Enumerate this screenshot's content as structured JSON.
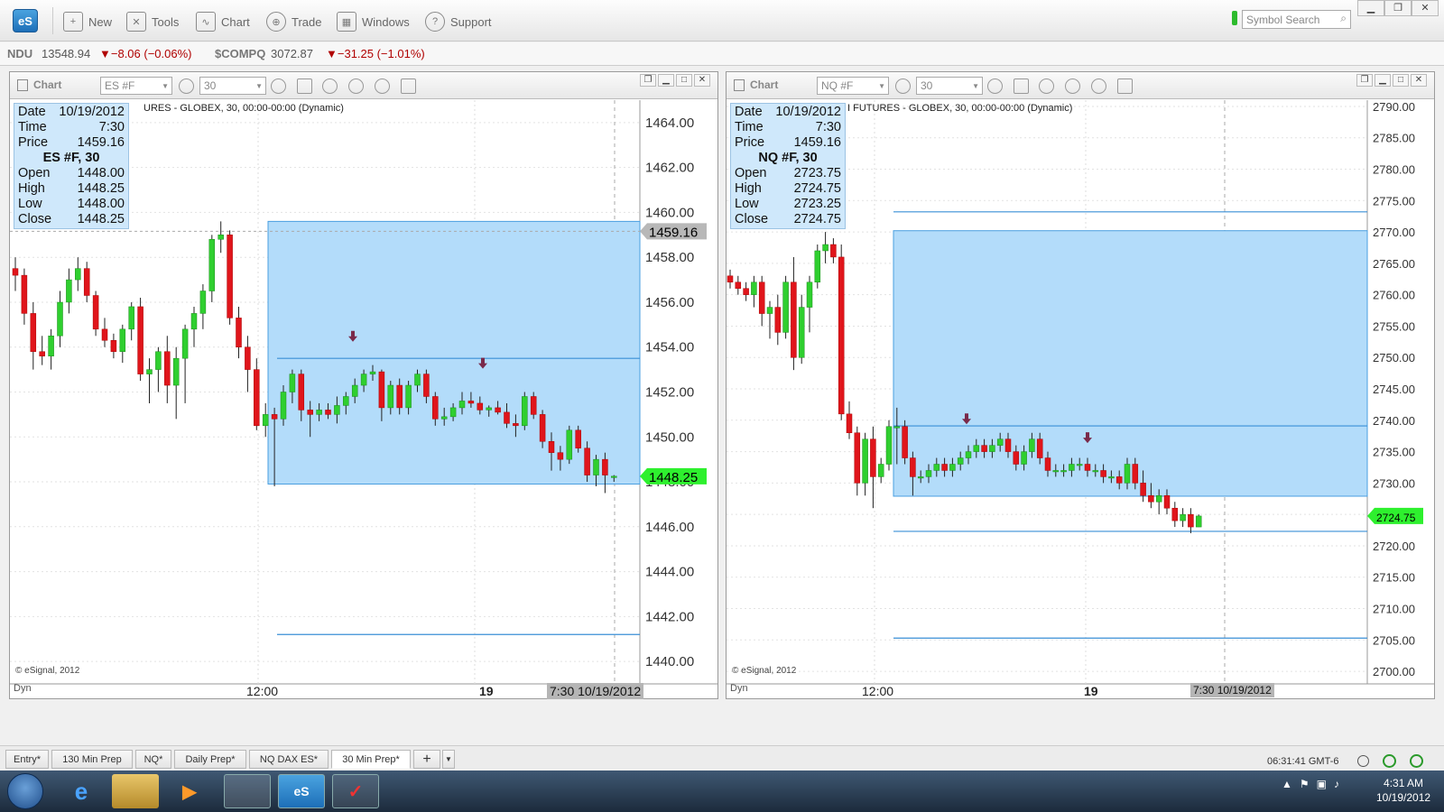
{
  "app": {
    "logo": "eS"
  },
  "toolbar": {
    "new": "New",
    "tools": "Tools",
    "chart": "Chart",
    "trade": "Trade",
    "windows": "Windows",
    "support": "Support",
    "symbol_search_placeholder": "Symbol Search"
  },
  "ticker": {
    "ndu_sym": "NDU",
    "ndu_val": "13548.94",
    "ndu_chg": "▼−8.06 (−0.06%)",
    "comp_sym": "$COMPQ",
    "comp_val": "3072.87",
    "comp_chg": "▼−31.25 (−1.01%)"
  },
  "panels": [
    {
      "title": "Chart",
      "symbol": "ES #F",
      "interval": "30",
      "description": "URES - GLOBEX, 30, 00:00-00:00 (Dynamic)",
      "info": {
        "date_label": "Date",
        "date": "10/19/2012",
        "time_label": "Time",
        "time": "7:30",
        "price_label": "Price",
        "price": "1459.16",
        "title": "ES #F, 30",
        "open_label": "Open",
        "open": "1448.00",
        "high_label": "High",
        "high": "1448.25",
        "low_label": "Low",
        "low": "1448.00",
        "close_label": "Close",
        "close": "1448.25"
      },
      "copyright": "© eSignal, 2012",
      "xlabel_1": "12:00",
      "xlabel_2": "19",
      "xcursor": "7:30 10/19/2012",
      "dyn": "Dyn",
      "cursor_price": "1459.16",
      "last_price": "1448.25"
    },
    {
      "title": "Chart",
      "symbol": "NQ #F",
      "interval": "30",
      "description": "I FUTURES - GLOBEX, 30, 00:00-00:00 (Dynamic)",
      "info": {
        "date_label": "Date",
        "date": "10/19/2012",
        "time_label": "Time",
        "time": "7:30",
        "price_label": "Price",
        "price": "1459.16",
        "title": "NQ #F, 30",
        "open_label": "Open",
        "open": "2723.75",
        "high_label": "High",
        "high": "2724.75",
        "low_label": "Low",
        "low": "2723.25",
        "close_label": "Close",
        "close": "2724.75"
      },
      "copyright": "© eSignal, 2012",
      "xlabel_1": "12:00",
      "xlabel_2": "19",
      "xcursor": "7:30 10/19/2012",
      "dyn": "Dyn",
      "last_price": "2724.75"
    }
  ],
  "chart_data": [
    {
      "type": "candlestick",
      "title": "ES #F, 30",
      "ylim": [
        1439,
        1465
      ],
      "yticks": [
        1440,
        1442,
        1444,
        1446,
        1448,
        1450,
        1452,
        1454,
        1456,
        1458,
        1460,
        1462,
        1464
      ],
      "ytick_labels": [
        "1440.00",
        "1442.00",
        "1444.00",
        "1446.00",
        "1448.00",
        "1450.00",
        "1452.00",
        "1454.00",
        "1456.00",
        "1458.00",
        "1460.00",
        "1462.00",
        "1464.00"
      ],
      "xticks": [
        "12:00",
        "19"
      ],
      "candles": [
        [
          1457.5,
          1458.0,
          1456.5,
          1457.2
        ],
        [
          1457.2,
          1457.5,
          1455.0,
          1455.5
        ],
        [
          1455.5,
          1456.0,
          1453.0,
          1453.8
        ],
        [
          1453.8,
          1454.5,
          1453.2,
          1453.6
        ],
        [
          1453.6,
          1454.8,
          1453.0,
          1454.5
        ],
        [
          1454.5,
          1456.5,
          1454.0,
          1456.0
        ],
        [
          1456.0,
          1457.5,
          1455.5,
          1457.0
        ],
        [
          1457.0,
          1458.0,
          1456.5,
          1457.5
        ],
        [
          1457.5,
          1457.8,
          1456.0,
          1456.3
        ],
        [
          1456.3,
          1456.5,
          1454.5,
          1454.8
        ],
        [
          1454.8,
          1455.3,
          1454.0,
          1454.3
        ],
        [
          1454.3,
          1454.6,
          1453.5,
          1453.8
        ],
        [
          1453.8,
          1455.0,
          1453.3,
          1454.8
        ],
        [
          1454.8,
          1456.0,
          1454.3,
          1455.8
        ],
        [
          1455.8,
          1456.2,
          1452.5,
          1452.8
        ],
        [
          1452.8,
          1453.5,
          1451.5,
          1453.0
        ],
        [
          1453.0,
          1454.0,
          1452.0,
          1453.8
        ],
        [
          1453.8,
          1454.5,
          1451.5,
          1452.3
        ],
        [
          1452.3,
          1454.0,
          1450.8,
          1453.5
        ],
        [
          1453.5,
          1455.0,
          1451.5,
          1454.8
        ],
        [
          1454.8,
          1455.8,
          1454.0,
          1455.5
        ],
        [
          1455.5,
          1456.8,
          1454.8,
          1456.5
        ],
        [
          1456.5,
          1459.0,
          1456.0,
          1458.8
        ],
        [
          1458.8,
          1459.6,
          1458.2,
          1459.0
        ],
        [
          1459.0,
          1459.2,
          1455.0,
          1455.3
        ],
        [
          1455.3,
          1455.8,
          1453.5,
          1454.0
        ],
        [
          1454.0,
          1454.5,
          1452.0,
          1453.0
        ],
        [
          1453.0,
          1453.5,
          1450.3,
          1450.5
        ],
        [
          1450.5,
          1451.5,
          1450.0,
          1451.0
        ],
        [
          1451.0,
          1451.3,
          1447.8,
          1450.8
        ],
        [
          1450.8,
          1452.3,
          1450.5,
          1452.0
        ],
        [
          1452.0,
          1453.0,
          1451.5,
          1452.8
        ],
        [
          1452.8,
          1453.0,
          1450.7,
          1451.2
        ],
        [
          1451.2,
          1451.6,
          1450.0,
          1451.0
        ],
        [
          1451.0,
          1451.5,
          1450.7,
          1451.2
        ],
        [
          1451.2,
          1451.5,
          1450.8,
          1451.0
        ],
        [
          1451.0,
          1451.8,
          1450.6,
          1451.4
        ],
        [
          1451.4,
          1452.0,
          1451.0,
          1451.8
        ],
        [
          1451.8,
          1452.6,
          1451.5,
          1452.3
        ],
        [
          1452.3,
          1453.0,
          1452.0,
          1452.8
        ],
        [
          1452.8,
          1453.2,
          1452.5,
          1452.9
        ],
        [
          1452.9,
          1453.0,
          1450.7,
          1451.3
        ],
        [
          1451.3,
          1452.5,
          1451.0,
          1452.3
        ],
        [
          1452.3,
          1452.6,
          1451.0,
          1451.3
        ],
        [
          1451.3,
          1452.5,
          1451.0,
          1452.3
        ],
        [
          1452.3,
          1453.0,
          1452.0,
          1452.8
        ],
        [
          1452.8,
          1453.0,
          1451.5,
          1451.8
        ],
        [
          1451.8,
          1452.0,
          1450.5,
          1450.8
        ],
        [
          1450.8,
          1451.3,
          1450.5,
          1450.9
        ],
        [
          1450.9,
          1451.5,
          1450.7,
          1451.3
        ],
        [
          1451.3,
          1452.0,
          1451.0,
          1451.6
        ],
        [
          1451.6,
          1452.0,
          1451.3,
          1451.5
        ],
        [
          1451.5,
          1451.8,
          1451.0,
          1451.2
        ],
        [
          1451.2,
          1451.4,
          1450.9,
          1451.3
        ],
        [
          1451.3,
          1451.6,
          1451.0,
          1451.1
        ],
        [
          1451.1,
          1451.5,
          1450.4,
          1450.6
        ],
        [
          1450.6,
          1451.0,
          1450.0,
          1450.5
        ],
        [
          1450.5,
          1452.0,
          1450.3,
          1451.8
        ],
        [
          1451.8,
          1452.0,
          1450.8,
          1451.0
        ],
        [
          1451.0,
          1451.2,
          1449.5,
          1449.8
        ],
        [
          1449.8,
          1450.2,
          1448.5,
          1449.3
        ],
        [
          1449.3,
          1449.6,
          1448.5,
          1449.0
        ],
        [
          1449.0,
          1450.5,
          1448.8,
          1450.3
        ],
        [
          1450.3,
          1450.5,
          1449.3,
          1449.5
        ],
        [
          1449.5,
          1449.8,
          1448.0,
          1448.3
        ],
        [
          1448.3,
          1449.2,
          1447.8,
          1449.0
        ],
        [
          1449.0,
          1449.3,
          1447.5,
          1448.3
        ],
        [
          1448.25,
          1448.3,
          1448.0,
          1448.25
        ]
      ],
      "shaded_zone": [
        1447.9,
        1459.6
      ],
      "hlines": [
        1453.5,
        1441.2
      ],
      "markers": [
        1454.0,
        1452.8
      ]
    },
    {
      "type": "candlestick",
      "title": "NQ #F, 30",
      "ylim": [
        2698,
        2791
      ],
      "yticks": [
        2700,
        2705,
        2710,
        2715,
        2720,
        2725,
        2730,
        2735,
        2740,
        2745,
        2750,
        2755,
        2760,
        2765,
        2770,
        2775,
        2780,
        2785,
        2790
      ],
      "ytick_labels": [
        "2700.00",
        "2705.00",
        "2710.00",
        "2715.00",
        "2720.00",
        "2725.00",
        "2730.00",
        "2735.00",
        "2740.00",
        "2745.00",
        "2750.00",
        "2755.00",
        "2760.00",
        "2765.00",
        "2770.00",
        "2775.00",
        "2780.00",
        "2785.00",
        "2790.00"
      ],
      "xticks": [
        "12:00",
        "19"
      ],
      "candles": [
        [
          2763,
          2764,
          2761,
          2762
        ],
        [
          2762,
          2763,
          2760,
          2761
        ],
        [
          2761,
          2762,
          2759,
          2760
        ],
        [
          2760,
          2763,
          2758,
          2762
        ],
        [
          2762,
          2763,
          2755,
          2757
        ],
        [
          2757,
          2759,
          2753,
          2758
        ],
        [
          2758,
          2760,
          2752,
          2754
        ],
        [
          2754,
          2763,
          2753,
          2762
        ],
        [
          2762,
          2766,
          2748,
          2750
        ],
        [
          2750,
          2760,
          2749,
          2758
        ],
        [
          2758,
          2763,
          2754,
          2762
        ],
        [
          2762,
          2768,
          2761,
          2767
        ],
        [
          2767,
          2770,
          2765,
          2768
        ],
        [
          2768,
          2769,
          2765,
          2766
        ],
        [
          2766,
          2768,
          2740,
          2741
        ],
        [
          2741,
          2743,
          2737,
          2738
        ],
        [
          2738,
          2739,
          2728,
          2730
        ],
        [
          2730,
          2738,
          2728,
          2737
        ],
        [
          2737,
          2739,
          2726,
          2731
        ],
        [
          2731,
          2734,
          2730,
          2733
        ],
        [
          2733,
          2740,
          2732,
          2739
        ],
        [
          2739,
          2742,
          2733,
          2739
        ],
        [
          2739,
          2740,
          2733,
          2734
        ],
        [
          2734,
          2735,
          2728,
          2731
        ],
        [
          2731,
          2732,
          2730,
          2731
        ],
        [
          2731,
          2733,
          2730,
          2732
        ],
        [
          2732,
          2734,
          2731,
          2733
        ],
        [
          2733,
          2734,
          2731,
          2732
        ],
        [
          2732,
          2734,
          2731,
          2733
        ],
        [
          2733,
          2735,
          2732,
          2734
        ],
        [
          2734,
          2736,
          2733,
          2735
        ],
        [
          2735,
          2737,
          2734,
          2736
        ],
        [
          2736,
          2737,
          2734,
          2735
        ],
        [
          2735,
          2737,
          2734,
          2736
        ],
        [
          2736,
          2738,
          2735,
          2737
        ],
        [
          2737,
          2738,
          2734,
          2735
        ],
        [
          2735,
          2736,
          2732,
          2733
        ],
        [
          2733,
          2736,
          2732,
          2735
        ],
        [
          2735,
          2738,
          2734,
          2737
        ],
        [
          2737,
          2738,
          2733,
          2734
        ],
        [
          2734,
          2735,
          2731,
          2732
        ],
        [
          2732,
          2733,
          2731,
          2732
        ],
        [
          2732,
          2733,
          2731,
          2732
        ],
        [
          2732,
          2734,
          2731,
          2733
        ],
        [
          2733,
          2734,
          2732,
          2733
        ],
        [
          2733,
          2734,
          2731,
          2732
        ],
        [
          2732,
          2733,
          2731,
          2732
        ],
        [
          2732,
          2733,
          2730,
          2731
        ],
        [
          2731,
          2732,
          2730,
          2731
        ],
        [
          2731,
          2732,
          2729,
          2730
        ],
        [
          2730,
          2734,
          2729,
          2733
        ],
        [
          2733,
          2734,
          2729,
          2730
        ],
        [
          2730,
          2732,
          2727,
          2728
        ],
        [
          2728,
          2730,
          2726,
          2727
        ],
        [
          2727,
          2729,
          2725,
          2728
        ],
        [
          2728,
          2729,
          2725,
          2726
        ],
        [
          2726,
          2727,
          2723,
          2724
        ],
        [
          2724,
          2726,
          2723,
          2725
        ],
        [
          2725,
          2726,
          2722,
          2723
        ],
        [
          2723,
          2725,
          2723,
          2724.75
        ]
      ],
      "shaded_zone": [
        2727.9,
        2770.2
      ],
      "hlines": [
        2773.2,
        2739.1,
        2722.3,
        2705.3
      ],
      "markers": [
        2738.5,
        2735.5
      ]
    }
  ],
  "tabs": [
    "Entry*",
    "130 Min Prep",
    "NQ*",
    "Daily Prep*",
    "NQ DAX ES*",
    "30 Min Prep*"
  ],
  "status": {
    "clock": "06:31:41 GMT-6"
  },
  "taskbar": {
    "time": "4:31 AM",
    "date": "10/19/2012"
  }
}
